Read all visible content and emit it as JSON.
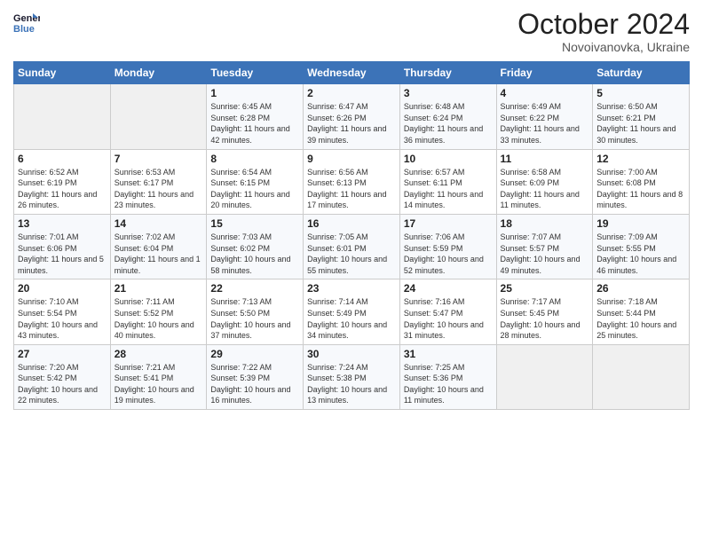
{
  "logo": {
    "line1": "General",
    "line2": "Blue"
  },
  "title": "October 2024",
  "location": "Novoivanovka, Ukraine",
  "days_of_week": [
    "Sunday",
    "Monday",
    "Tuesday",
    "Wednesday",
    "Thursday",
    "Friday",
    "Saturday"
  ],
  "weeks": [
    [
      {
        "day": "",
        "info": ""
      },
      {
        "day": "",
        "info": ""
      },
      {
        "day": "1",
        "info": "Sunrise: 6:45 AM\nSunset: 6:28 PM\nDaylight: 11 hours and 42 minutes."
      },
      {
        "day": "2",
        "info": "Sunrise: 6:47 AM\nSunset: 6:26 PM\nDaylight: 11 hours and 39 minutes."
      },
      {
        "day": "3",
        "info": "Sunrise: 6:48 AM\nSunset: 6:24 PM\nDaylight: 11 hours and 36 minutes."
      },
      {
        "day": "4",
        "info": "Sunrise: 6:49 AM\nSunset: 6:22 PM\nDaylight: 11 hours and 33 minutes."
      },
      {
        "day": "5",
        "info": "Sunrise: 6:50 AM\nSunset: 6:21 PM\nDaylight: 11 hours and 30 minutes."
      }
    ],
    [
      {
        "day": "6",
        "info": "Sunrise: 6:52 AM\nSunset: 6:19 PM\nDaylight: 11 hours and 26 minutes."
      },
      {
        "day": "7",
        "info": "Sunrise: 6:53 AM\nSunset: 6:17 PM\nDaylight: 11 hours and 23 minutes."
      },
      {
        "day": "8",
        "info": "Sunrise: 6:54 AM\nSunset: 6:15 PM\nDaylight: 11 hours and 20 minutes."
      },
      {
        "day": "9",
        "info": "Sunrise: 6:56 AM\nSunset: 6:13 PM\nDaylight: 11 hours and 17 minutes."
      },
      {
        "day": "10",
        "info": "Sunrise: 6:57 AM\nSunset: 6:11 PM\nDaylight: 11 hours and 14 minutes."
      },
      {
        "day": "11",
        "info": "Sunrise: 6:58 AM\nSunset: 6:09 PM\nDaylight: 11 hours and 11 minutes."
      },
      {
        "day": "12",
        "info": "Sunrise: 7:00 AM\nSunset: 6:08 PM\nDaylight: 11 hours and 8 minutes."
      }
    ],
    [
      {
        "day": "13",
        "info": "Sunrise: 7:01 AM\nSunset: 6:06 PM\nDaylight: 11 hours and 5 minutes."
      },
      {
        "day": "14",
        "info": "Sunrise: 7:02 AM\nSunset: 6:04 PM\nDaylight: 11 hours and 1 minute."
      },
      {
        "day": "15",
        "info": "Sunrise: 7:03 AM\nSunset: 6:02 PM\nDaylight: 10 hours and 58 minutes."
      },
      {
        "day": "16",
        "info": "Sunrise: 7:05 AM\nSunset: 6:01 PM\nDaylight: 10 hours and 55 minutes."
      },
      {
        "day": "17",
        "info": "Sunrise: 7:06 AM\nSunset: 5:59 PM\nDaylight: 10 hours and 52 minutes."
      },
      {
        "day": "18",
        "info": "Sunrise: 7:07 AM\nSunset: 5:57 PM\nDaylight: 10 hours and 49 minutes."
      },
      {
        "day": "19",
        "info": "Sunrise: 7:09 AM\nSunset: 5:55 PM\nDaylight: 10 hours and 46 minutes."
      }
    ],
    [
      {
        "day": "20",
        "info": "Sunrise: 7:10 AM\nSunset: 5:54 PM\nDaylight: 10 hours and 43 minutes."
      },
      {
        "day": "21",
        "info": "Sunrise: 7:11 AM\nSunset: 5:52 PM\nDaylight: 10 hours and 40 minutes."
      },
      {
        "day": "22",
        "info": "Sunrise: 7:13 AM\nSunset: 5:50 PM\nDaylight: 10 hours and 37 minutes."
      },
      {
        "day": "23",
        "info": "Sunrise: 7:14 AM\nSunset: 5:49 PM\nDaylight: 10 hours and 34 minutes."
      },
      {
        "day": "24",
        "info": "Sunrise: 7:16 AM\nSunset: 5:47 PM\nDaylight: 10 hours and 31 minutes."
      },
      {
        "day": "25",
        "info": "Sunrise: 7:17 AM\nSunset: 5:45 PM\nDaylight: 10 hours and 28 minutes."
      },
      {
        "day": "26",
        "info": "Sunrise: 7:18 AM\nSunset: 5:44 PM\nDaylight: 10 hours and 25 minutes."
      }
    ],
    [
      {
        "day": "27",
        "info": "Sunrise: 7:20 AM\nSunset: 5:42 PM\nDaylight: 10 hours and 22 minutes."
      },
      {
        "day": "28",
        "info": "Sunrise: 7:21 AM\nSunset: 5:41 PM\nDaylight: 10 hours and 19 minutes."
      },
      {
        "day": "29",
        "info": "Sunrise: 7:22 AM\nSunset: 5:39 PM\nDaylight: 10 hours and 16 minutes."
      },
      {
        "day": "30",
        "info": "Sunrise: 7:24 AM\nSunset: 5:38 PM\nDaylight: 10 hours and 13 minutes."
      },
      {
        "day": "31",
        "info": "Sunrise: 7:25 AM\nSunset: 5:36 PM\nDaylight: 10 hours and 11 minutes."
      },
      {
        "day": "",
        "info": ""
      },
      {
        "day": "",
        "info": ""
      }
    ]
  ]
}
